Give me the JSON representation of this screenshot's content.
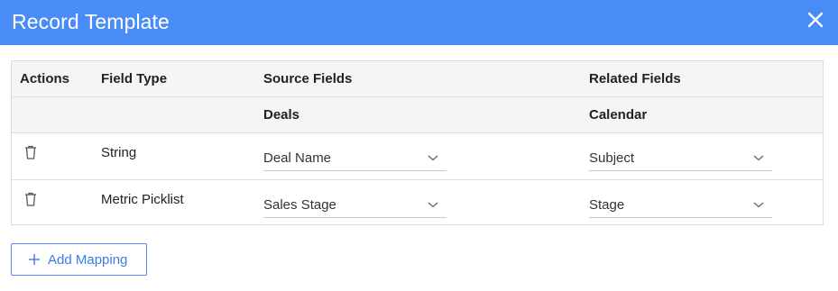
{
  "dialog": {
    "title": "Record Template",
    "close_icon": "close-icon",
    "accent_color": "#4a8cf7"
  },
  "table": {
    "headers": {
      "actions": "Actions",
      "field_type": "Field Type",
      "source_fields": "Source Fields",
      "related_fields": "Related Fields"
    },
    "subheaders": {
      "source": "Deals",
      "related": "Calendar"
    },
    "rows": [
      {
        "action_icon": "trash-icon",
        "field_type": "String",
        "source": "Deal Name",
        "related": "Subject"
      },
      {
        "action_icon": "trash-icon",
        "field_type": "Metric Picklist",
        "source": "Sales Stage",
        "related": "Stage"
      }
    ]
  },
  "add_mapping": {
    "label": "Add Mapping",
    "icon": "plus-icon"
  }
}
